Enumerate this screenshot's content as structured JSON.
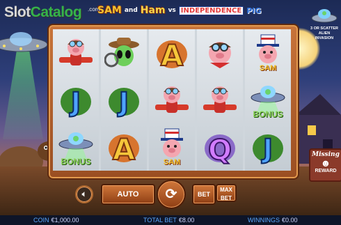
{
  "watermark": {
    "brand_slot": "Slot",
    "brand_catalog": "Catalog",
    "suffix": ".com"
  },
  "title": {
    "sam": "SAM",
    "and": "and",
    "ham": "Ham",
    "vs": "vs",
    "independence": "INDEPENDENCE",
    "pig": "PIG"
  },
  "badge": {
    "line1": "3 OR SCATTER",
    "line2": "ALIEN INVASION"
  },
  "sign": {
    "line1": "Missing",
    "line2": "REWARD"
  },
  "reels": [
    [
      {
        "symbol": "pilot-pig"
      },
      {
        "symbol": "J"
      },
      {
        "symbol": "ufo-bonus",
        "label": "BONUS"
      }
    ],
    [
      {
        "symbol": "alien-cowboy"
      },
      {
        "symbol": "J"
      },
      {
        "symbol": "A"
      }
    ],
    [
      {
        "symbol": "A"
      },
      {
        "symbol": "pilot-pig"
      },
      {
        "symbol": "sam-pig",
        "label": "SAM"
      }
    ],
    [
      {
        "symbol": "goggles-pig"
      },
      {
        "symbol": "pilot-pig"
      },
      {
        "symbol": "Q"
      }
    ],
    [
      {
        "symbol": "sam-pig",
        "label": "SAM"
      },
      {
        "symbol": "ufo-bonus",
        "label": "BONUS"
      },
      {
        "symbol": "J"
      }
    ]
  ],
  "controls": {
    "auto": "AUTO",
    "bet": "BET",
    "max_bet_1": "MAX",
    "max_bet_2": "BET",
    "sound_icon": "speaker-icon",
    "spin_icon": "spin-arrow-icon"
  },
  "status": {
    "coin_label": "COIN",
    "coin_value": "€1,000.00",
    "total_bet_label": "TOTAL BET",
    "total_bet_value": "€8.00",
    "winnings_label": "WINNINGS",
    "winnings_value": "€0.00"
  }
}
